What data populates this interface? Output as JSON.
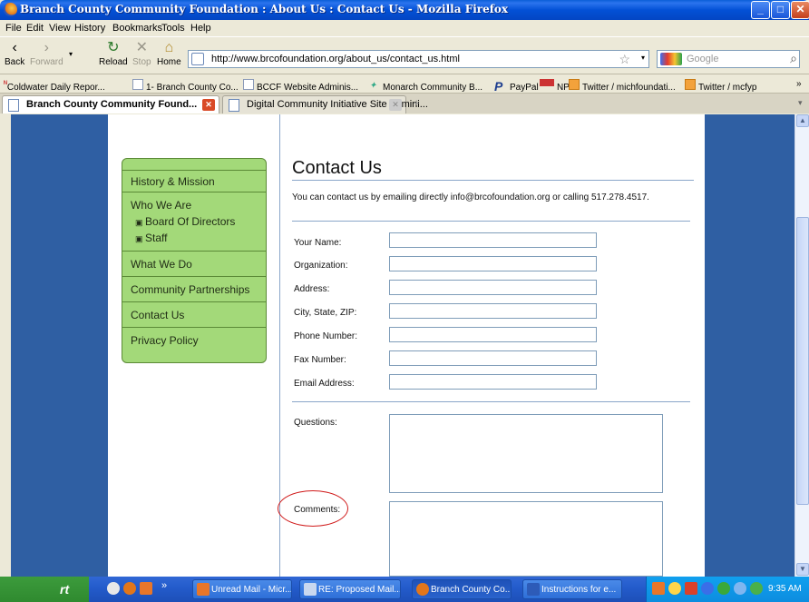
{
  "browser": {
    "window_title": "Branch County Community Foundation : About Us : Contact Us - Mozilla Firefox",
    "menu": [
      "File",
      "Edit",
      "View",
      "History",
      "Bookmarks",
      "Tools",
      "Help"
    ],
    "nav": {
      "back": "Back",
      "forward": "Forward",
      "reload": "Reload",
      "stop": "Stop",
      "home": "Home"
    },
    "url": "http://www.brcofoundation.org/about_us/contact_us.html",
    "search_placeholder": "Google",
    "bookmarks": [
      "Coldwater Daily Repor...",
      "1- Branch County Co...",
      "BCCF Website Adminis...",
      "Monarch Community B...",
      "PayPal",
      "NPR",
      "Twitter / michfoundati...",
      "Twitter / mcfyp"
    ],
    "bookmarks_more": "»",
    "tabs": [
      {
        "label": "Branch County Community Found...",
        "active": true
      },
      {
        "label": "Digital Community Initiative Site Admini...",
        "active": false
      }
    ]
  },
  "sidebar": {
    "items": [
      {
        "label": "History & Mission"
      },
      {
        "label": "Who We Are",
        "children": [
          "Board Of Directors",
          "Staff"
        ]
      },
      {
        "label": "What We Do"
      },
      {
        "label": "Community Partnerships"
      },
      {
        "label": "Contact Us"
      },
      {
        "label": "Privacy Policy"
      }
    ]
  },
  "main": {
    "title": "Contact Us",
    "intro": "You can contact us by emailing directly info@brcofoundation.org or calling 517.278.4517.",
    "fields": [
      "Your Name:",
      "Organization:",
      "Address:",
      "City, State, ZIP:",
      "Phone Number:",
      "Fax Number:",
      "Email Address:"
    ],
    "questions_label": "Questions:",
    "comments_label": "Comments:"
  },
  "taskbar": {
    "start": "rt",
    "buttons": [
      "Unread Mail - Micr...",
      "RE: Proposed Mail...",
      "Branch County Co...",
      "Instructions for e..."
    ],
    "clock": "9:35 AM",
    "quicklaunch_more": "»"
  },
  "colors": {
    "nav_green": "#a3d979",
    "accent_blue": "#8aa6c9",
    "annotation_red": "#d01a1a"
  }
}
